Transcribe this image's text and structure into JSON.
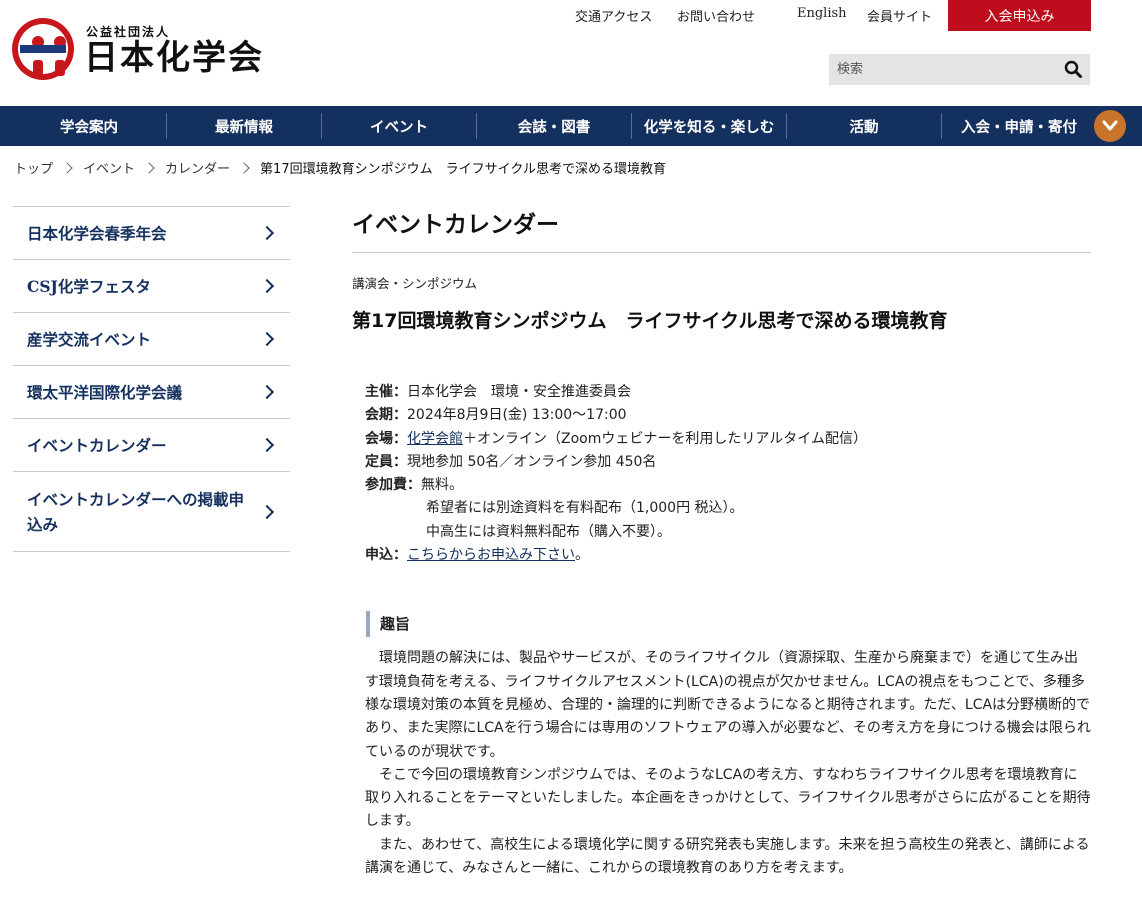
{
  "header": {
    "logo_subtitle": "公益社団法人",
    "logo_title": "日本化学会",
    "util_links": [
      "交通アクセス",
      "お問い合わせ",
      "English",
      "会員サイト"
    ],
    "join_label": "入会申込み",
    "search_placeholder": "検索"
  },
  "nav": {
    "items": [
      "学会案内",
      "最新情報",
      "イベント",
      "会誌・図書",
      "化学を知る・楽しむ",
      "活動",
      "入会・申請・寄付"
    ]
  },
  "breadcrumb": {
    "items": [
      "トップ",
      "イベント",
      "カレンダー"
    ],
    "current": "第17回環境教育シンポジウム　ライフサイクル思考で深める環境教育"
  },
  "sidebar": {
    "items": [
      "日本化学会春季年会",
      "CSJ化学フェスタ",
      "産学交流イベント",
      "環太平洋国際化学会議",
      "イベントカレンダー",
      "イベントカレンダーへの掲載申込み"
    ]
  },
  "main": {
    "heading": "イベントカレンダー",
    "category": "講演会・シンポジウム",
    "title": "第17回環境教育シンポジウム　ライフサイクル思考で深める環境教育",
    "details": {
      "organizer_label": "主催：",
      "organizer": "日本化学会　環境・安全推進委員会",
      "date_label": "会期：",
      "date": "2024年8月9日(金) 13:00～17:00",
      "venue_label": "会場：",
      "venue_link": "化学会館",
      "venue_rest": "＋オンライン（Zoomウェビナーを利用したリアルタイム配信）",
      "capacity_label": "定員：",
      "capacity": "現地参加 50名／オンライン参加 450名",
      "fee_label": "参加費：",
      "fee": "無料。",
      "fee_note1": "希望者には別途資料を有料配布（1,000円 税込）。",
      "fee_note2": "中高生には資料無料配布（購入不要）。",
      "apply_label": "申込：",
      "apply_link": "こちらからお申込み下さい",
      "apply_end": "。"
    },
    "section_title": "趣旨",
    "paragraphs": [
      "環境問題の解決には、製品やサービスが、そのライフサイクル（資源採取、生産から廃棄まで）を通じて生み出す環境負荷を考える、ライフサイクルアセスメント(LCA)の視点が欠かせません。LCAの視点をもつことで、多種多様な環境対策の本質を見極め、合理的・論理的に判断できるようになると期待されます。ただ、LCAは分野横断的であり、また実際にLCAを行う場合には専用のソフトウェアの導入が必要など、その考え方を身につける機会は限られているのが現状です。",
      "そこで今回の環境教育シンポジウムでは、そのようなLCAの考え方、すなわちライフサイクル思考を環境教育に取り入れることをテーマといたしました。本企画をきっかけとして、ライフサイクル思考がさらに広がることを期待します。",
      "また、あわせて、高校生による環境化学に関する研究発表も実施します。未来を担う高校生の発表と、講師による講演を通じて、みなさんと一緒に、これからの環境教育のあり方を考えます。"
    ]
  }
}
